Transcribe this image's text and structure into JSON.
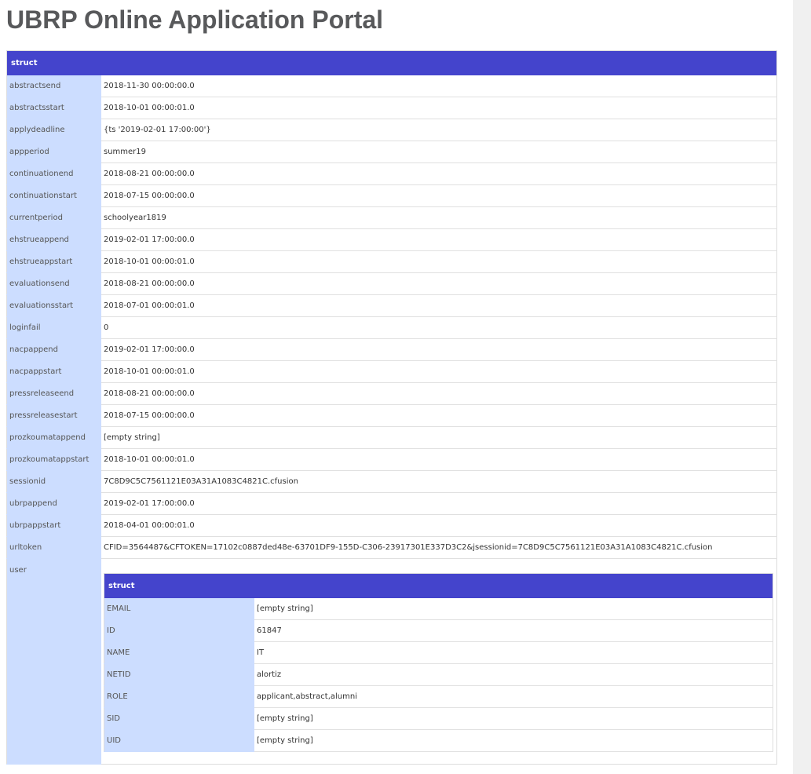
{
  "page_title": "UBRP Online Application Portal",
  "dump": {
    "header": "struct",
    "rows": [
      {
        "key": "abstractsend",
        "value": "2018-11-30 00:00:00.0"
      },
      {
        "key": "abstractsstart",
        "value": "2018-10-01 00:00:01.0"
      },
      {
        "key": "applydeadline",
        "value": "{ts '2019-02-01 17:00:00'}"
      },
      {
        "key": "appperiod",
        "value": "summer19"
      },
      {
        "key": "continuationend",
        "value": "2018-08-21 00:00:00.0"
      },
      {
        "key": "continuationstart",
        "value": "2018-07-15 00:00:00.0"
      },
      {
        "key": "currentperiod",
        "value": "schoolyear1819"
      },
      {
        "key": "ehstrueappend",
        "value": "2019-02-01 17:00:00.0"
      },
      {
        "key": "ehstrueappstart",
        "value": "2018-10-01 00:00:01.0"
      },
      {
        "key": "evaluationsend",
        "value": "2018-08-21 00:00:00.0"
      },
      {
        "key": "evaluationsstart",
        "value": "2018-07-01 00:00:01.0"
      },
      {
        "key": "loginfail",
        "value": "0"
      },
      {
        "key": "nacpappend",
        "value": "2019-02-01 17:00:00.0"
      },
      {
        "key": "nacpappstart",
        "value": "2018-10-01 00:00:01.0"
      },
      {
        "key": "pressreleaseend",
        "value": "2018-08-21 00:00:00.0"
      },
      {
        "key": "pressreleasestart",
        "value": "2018-07-15 00:00:00.0"
      },
      {
        "key": "prozkoumatappend",
        "value": "[empty string]"
      },
      {
        "key": "prozkoumatappstart",
        "value": "2018-10-01 00:00:01.0"
      },
      {
        "key": "sessionid",
        "value": "7C8D9C5C7561121E03A31A1083C4821C.cfusion"
      },
      {
        "key": "ubrpappend",
        "value": "2019-02-01 17:00:00.0"
      },
      {
        "key": "ubrpappstart",
        "value": "2018-04-01 00:00:01.0"
      },
      {
        "key": "urltoken",
        "value": "CFID=3564487&CFTOKEN=17102c0887ded48e-63701DF9-155D-C306-23917301E337D3C2&jsessionid=7C8D9C5C7561121E03A31A1083C4821C.cfusion"
      }
    ],
    "user": {
      "key": "user",
      "header": "struct",
      "rows": [
        {
          "key": "EMAIL",
          "value": "[empty string]"
        },
        {
          "key": "ID",
          "value": "61847"
        },
        {
          "key": "NAME",
          "value": "IT"
        },
        {
          "key": "NETID",
          "value": "alortiz"
        },
        {
          "key": "ROLE",
          "value": "applicant,abstract,alumni"
        },
        {
          "key": "SID",
          "value": "[empty string]"
        },
        {
          "key": "UID",
          "value": "[empty string]"
        }
      ]
    }
  },
  "colors": {
    "header_bg": "#4444cc",
    "key_bg": "#ccddff",
    "title_text": "#58595b"
  }
}
